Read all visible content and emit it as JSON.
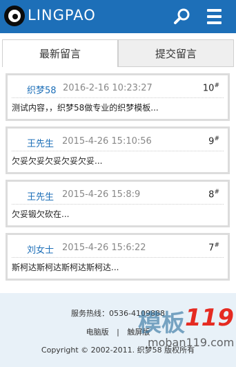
{
  "header": {
    "logo_text": "LINGPAO",
    "accent_color": "#1d6fb8",
    "search_icon": "search-icon",
    "menu_icon": "hamburger-menu-icon"
  },
  "tabs": [
    {
      "label": "最新留言",
      "active": true
    },
    {
      "label": "提交留言",
      "active": false
    }
  ],
  "messages": [
    {
      "name": "织梦58",
      "date": "2016-2-16 10:23:27",
      "floor": "10",
      "floor_mark": "#",
      "content": "测试内容，，织梦58做专业的织梦模板..."
    },
    {
      "name": "王先生",
      "date": "2015-4-26 15:10:56",
      "floor": "9",
      "floor_mark": "#",
      "content": "欠妥欠妥欠妥欠妥欠妥..."
    },
    {
      "name": "王先生",
      "date": "2015-4-26 15:8:9",
      "floor": "8",
      "floor_mark": "#",
      "content": "欠妥锻欠砍在..."
    },
    {
      "name": "刘女士",
      "date": "2015-4-26 15:6:22",
      "floor": "7",
      "floor_mark": "#",
      "content": "斯柯达斯柯达斯柯达斯柯达..."
    }
  ],
  "footer": {
    "hotline": "服务热线：0536-4109888",
    "link_pc": "电脑版",
    "separator": "|",
    "link_touch": "触屏版",
    "copyright": "Copyright © 2002-2011. 织梦58 版权所有"
  },
  "watermark": {
    "brand_zh": "模板",
    "brand_num": "119",
    "url": "moban119.com"
  }
}
